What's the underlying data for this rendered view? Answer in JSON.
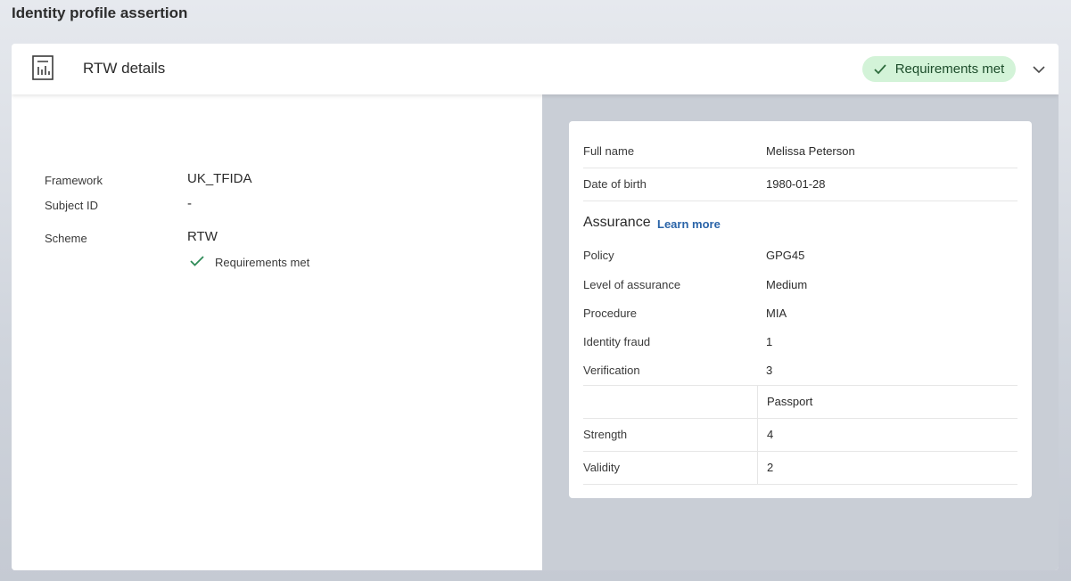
{
  "page": {
    "title": "Identity profile assertion"
  },
  "card": {
    "header_title": "RTW details",
    "status_label": "Requirements met",
    "status_color": "#d3f3d8",
    "doc_icon": "document-chart-icon",
    "expand_icon": "chevron-down-icon"
  },
  "details": {
    "framework_label": "Framework",
    "framework_value": "UK_TFIDA",
    "subject_label": "Subject ID",
    "subject_value": "-",
    "scheme_label": "Scheme",
    "scheme_value": "RTW",
    "scheme_status": "Requirements met"
  },
  "profile": {
    "full_name_label": "Full name",
    "full_name_value": "Melissa Peterson",
    "dob_label": "Date of birth",
    "dob_value": "1980-01-28"
  },
  "assurance": {
    "title": "Assurance",
    "learn_more": "Learn more",
    "link_color": "#2a64a8",
    "policy_label": "Policy",
    "policy_value": "GPG45",
    "loa_label": "Level of assurance",
    "loa_value": "Medium",
    "procedure_label": "Procedure",
    "procedure_value": "MIA",
    "fraud_label": "Identity fraud",
    "fraud_value": "1",
    "verification_label": "Verification",
    "verification_value": "3",
    "evidence_header": "Passport",
    "strength_label": "Strength",
    "strength_value": "4",
    "validity_label": "Validity",
    "validity_value": "2"
  }
}
